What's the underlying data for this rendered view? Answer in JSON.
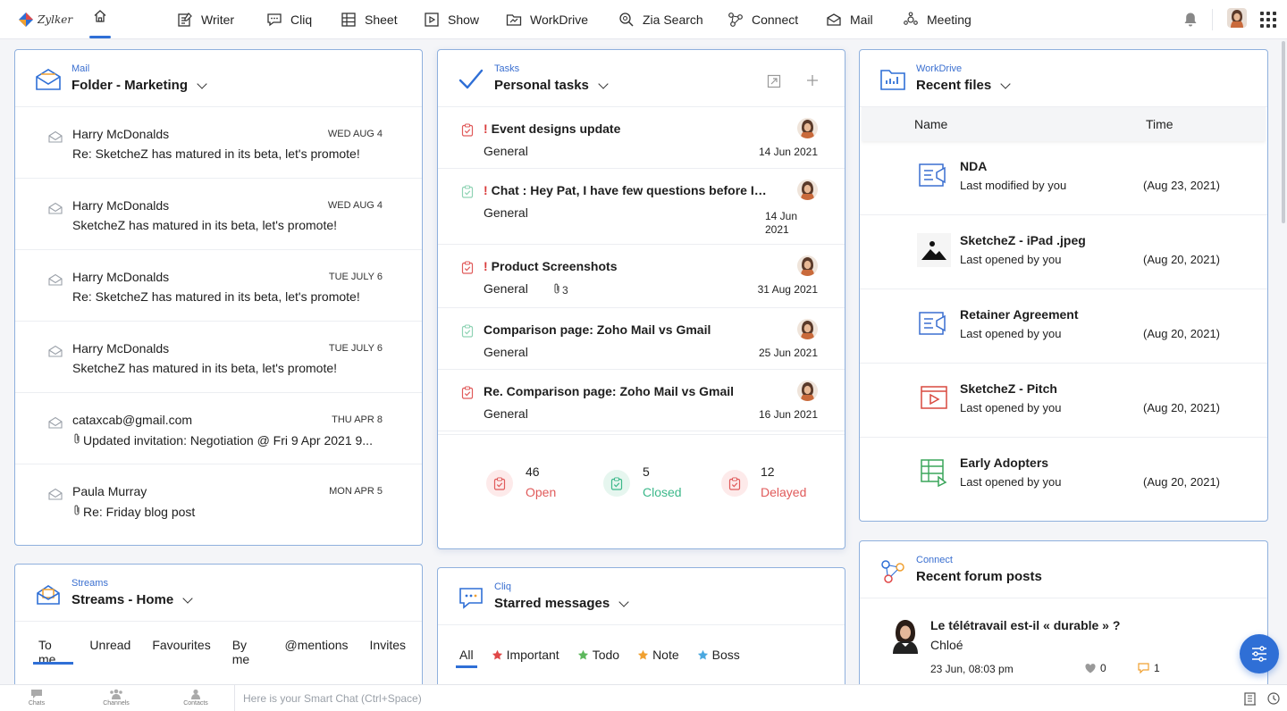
{
  "brand": {
    "logo_text": "Zylker"
  },
  "nav": [
    {
      "label": "Writer",
      "icon": "writer-icon"
    },
    {
      "label": "Cliq",
      "icon": "cliq-icon"
    },
    {
      "label": "Sheet",
      "icon": "sheet-icon"
    },
    {
      "label": "Show",
      "icon": "show-icon"
    },
    {
      "label": "WorkDrive",
      "icon": "workdrive-icon"
    },
    {
      "label": "Zia Search",
      "icon": "zia-search-icon"
    },
    {
      "label": "Connect",
      "icon": "connect-icon"
    },
    {
      "label": "Mail",
      "icon": "mail-icon"
    },
    {
      "label": "Meeting",
      "icon": "meeting-icon"
    }
  ],
  "mail": {
    "app": "Mail",
    "title": "Folder - Marketing",
    "items": [
      {
        "from": "Harry McDonalds",
        "date": "WED AUG 4",
        "subject": "Re: SketcheZ has matured in its beta, let's promote!",
        "attachment": false
      },
      {
        "from": "Harry McDonalds",
        "date": "WED AUG 4",
        "subject": "SketcheZ has matured in its beta, let's promote!",
        "attachment": false
      },
      {
        "from": "Harry McDonalds",
        "date": "TUE JULY 6",
        "subject": "Re: SketcheZ has matured in its beta, let's promote!",
        "attachment": false
      },
      {
        "from": "Harry McDonalds",
        "date": "TUE JULY 6",
        "subject": "SketcheZ has matured in its beta, let's promote!",
        "attachment": false
      },
      {
        "from": "cataxcab@gmail.com",
        "date": "THU APR 8",
        "subject": "Updated invitation: Negotiation @ Fri 9 Apr 2021 9...",
        "attachment": true
      },
      {
        "from": "Paula Murray",
        "date": "MON APR 5",
        "subject": "Re: Friday blog post",
        "attachment": true
      }
    ]
  },
  "tasks": {
    "app": "Tasks",
    "title": "Personal tasks",
    "items": [
      {
        "title": "Event designs update",
        "priority": "!",
        "list": "General",
        "date": "14 Jun 2021",
        "attachments": "",
        "status": "open"
      },
      {
        "title": "Chat : Hey Pat, I have few questions before I pu...",
        "priority": "!",
        "list": "General",
        "date_line1": "14 Jun",
        "date_line2": "2021",
        "attachments": "",
        "status": "closed"
      },
      {
        "title": "Product Screenshots",
        "priority": "!",
        "list": "General",
        "date": "31 Aug 2021",
        "attachments": "3",
        "status": "open"
      },
      {
        "title": "Comparison page: Zoho Mail vs Gmail",
        "priority": "",
        "list": "General",
        "date": "25 Jun 2021",
        "attachments": "",
        "status": "closed"
      },
      {
        "title": "Re. Comparison page: Zoho Mail vs Gmail",
        "priority": "",
        "list": "General",
        "date": "16 Jun 2021",
        "attachments": "",
        "status": "open"
      }
    ],
    "stats": [
      {
        "count": "46",
        "label": "Open",
        "color": "#e05a5a",
        "bg": "#fdeaea"
      },
      {
        "count": "5",
        "label": "Closed",
        "color": "#3cb88a",
        "bg": "#e6f6ef"
      },
      {
        "count": "12",
        "label": "Delayed",
        "color": "#e05a5a",
        "bg": "#fdeaea"
      }
    ]
  },
  "workdrive": {
    "app": "WorkDrive",
    "title": "Recent files",
    "col_name": "Name",
    "col_time": "Time",
    "files": [
      {
        "name": "NDA",
        "by": "Last modified by you",
        "time": "(Aug 23, 2021)",
        "icon": "document-icon"
      },
      {
        "name": "SketcheZ - iPad .jpeg",
        "by": "Last opened by you",
        "time": "(Aug 20, 2021)",
        "icon": "image-icon"
      },
      {
        "name": "Retainer Agreement",
        "by": "Last opened by you",
        "time": "(Aug 20, 2021)",
        "icon": "document-icon"
      },
      {
        "name": "SketcheZ - Pitch",
        "by": "Last opened by you",
        "time": "(Aug 20, 2021)",
        "icon": "presentation-icon"
      },
      {
        "name": "Early Adopters",
        "by": "Last opened by you",
        "time": "(Aug 20, 2021)",
        "icon": "spreadsheet-icon"
      }
    ]
  },
  "streams": {
    "app": "Streams",
    "title": "Streams - Home",
    "tabs": [
      "To me",
      "Unread",
      "Favourites",
      "By me",
      "@mentions",
      "Invites"
    ]
  },
  "cliq": {
    "app": "Cliq",
    "title": "Starred messages",
    "filters": [
      {
        "label": "All",
        "star_color": ""
      },
      {
        "label": "Important",
        "star_color": "#e04848"
      },
      {
        "label": "Todo",
        "star_color": "#5cb85c"
      },
      {
        "label": "Note",
        "star_color": "#f0a030"
      },
      {
        "label": "Boss",
        "star_color": "#4aa8e0"
      }
    ]
  },
  "connect": {
    "app": "Connect",
    "title": "Recent forum posts",
    "post": {
      "title": "Le télétravail est-il « durable » ?",
      "author": "Chloé",
      "time": "23 Jun, 08:03 pm",
      "likes": "0",
      "comments": "1"
    }
  },
  "bottombar": {
    "chats": "Chats",
    "channels": "Channels",
    "contacts": "Contacts",
    "smartchat_placeholder": "Here is your Smart Chat (Ctrl+Space)"
  },
  "colors": {
    "accent": "#2f6fd6",
    "card_border": "#8fb0dd",
    "alert": "#d93b3b"
  }
}
